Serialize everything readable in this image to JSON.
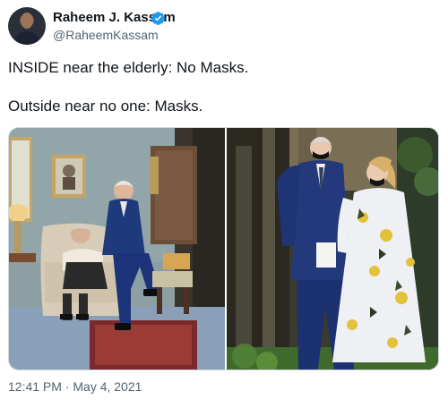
{
  "author": {
    "name": "Raheem J. Kassam",
    "handle": "@RaheemKassam",
    "verified_color": "#1d9bf0"
  },
  "tweet": {
    "line1": "INSIDE near the elderly: No Masks.",
    "line2": "Outside near no one: Masks."
  },
  "meta": {
    "timestamp": "12:41 PM · May 4, 2021"
  },
  "icons": {
    "verified": "verified-badge-icon"
  }
}
